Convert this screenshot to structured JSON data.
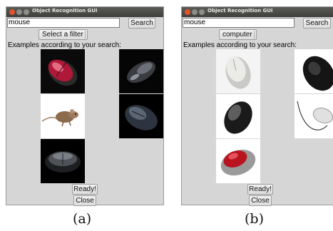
{
  "panels": [
    {
      "title": "Object Recognition GUI",
      "search_value": "mouse",
      "search_button": "Search",
      "filter_label": "Select a filter",
      "examples_label": "Examples according to your search:",
      "status_button": "Ready!",
      "close_button": "Close",
      "caption": "(a)"
    },
    {
      "title": "Object Recognition GUI",
      "search_value": "mouse",
      "search_button": "Search",
      "filter_label": "computer",
      "examples_label": "Examples according to your search:",
      "status_button": "Ready!",
      "close_button": "Close",
      "caption": "(b)"
    }
  ],
  "colors": {
    "window_bg": "#d6d6d6",
    "titlebar": "#4a4a47",
    "close_dot": "#e2522b"
  }
}
